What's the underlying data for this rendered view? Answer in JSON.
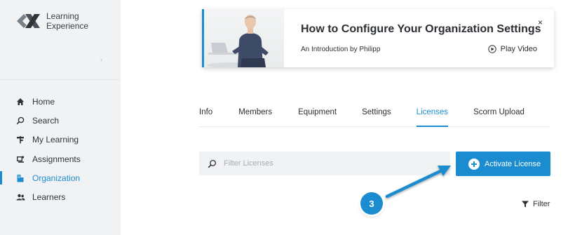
{
  "brand": {
    "name_line1": "Learning",
    "name_line2": "Experience"
  },
  "sidebar": {
    "collapse_icon": "chevron-right-icon",
    "items": [
      {
        "label": "Home",
        "icon": "home-icon",
        "active": false
      },
      {
        "label": "Search",
        "icon": "search-icon",
        "active": false
      },
      {
        "label": "My Learning",
        "icon": "signpost-icon",
        "active": false
      },
      {
        "label": "Assignments",
        "icon": "assignments-icon",
        "active": false
      },
      {
        "label": "Organization",
        "icon": "organization-icon",
        "active": true
      },
      {
        "label": "Learners",
        "icon": "users-icon",
        "active": false
      }
    ]
  },
  "banner": {
    "title": "How to Configure Your Organization Settings",
    "subtitle": "An Introduction by Philipp",
    "close": "×",
    "play_label": "Play Video"
  },
  "tabs": [
    {
      "label": "Info",
      "active": false
    },
    {
      "label": "Members",
      "active": false
    },
    {
      "label": "Equipment",
      "active": false
    },
    {
      "label": "Settings",
      "active": false
    },
    {
      "label": "Licenses",
      "active": true
    },
    {
      "label": "Scorm Upload",
      "active": false
    }
  ],
  "filter": {
    "placeholder": "Filter Licenses",
    "value": ""
  },
  "activate_button": {
    "label": "Activate License"
  },
  "filter_link": {
    "label": "Filter"
  },
  "callout": {
    "step": "3"
  },
  "colors": {
    "accent": "#1a8ccf",
    "sidebar_bg": "#f1f2f3",
    "text": "#2b2f33"
  }
}
